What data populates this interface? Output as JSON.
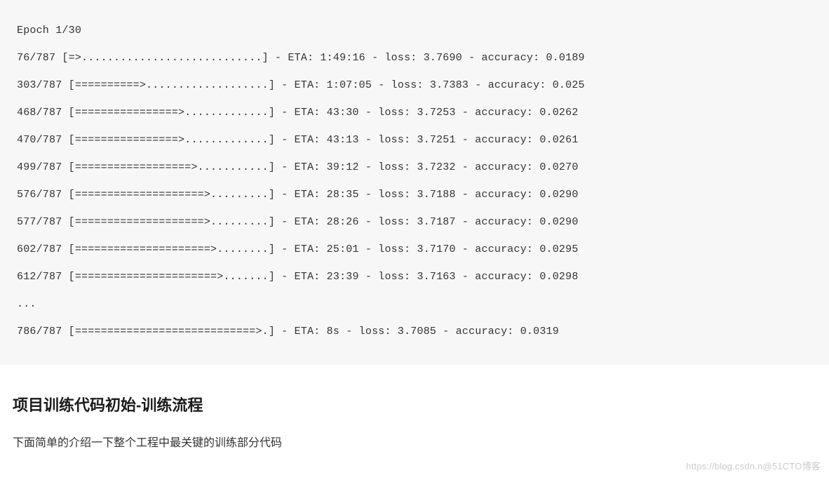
{
  "code": {
    "lines": [
      "Epoch 1/30",
      "76/787 [=>............................] - ETA: 1:49:16 - loss: 3.7690 - accuracy: 0.0189",
      "303/787 [==========>...................] - ETA: 1:07:05 - loss: 3.7383 - accuracy: 0.025",
      "468/787 [================>.............] - ETA: 43:30 - loss: 3.7253 - accuracy: 0.0262",
      "470/787 [================>.............] - ETA: 43:13 - loss: 3.7251 - accuracy: 0.0261",
      "499/787 [==================>...........] - ETA: 39:12 - loss: 3.7232 - accuracy: 0.0270",
      "576/787 [====================>.........] - ETA: 28:35 - loss: 3.7188 - accuracy: 0.0290",
      "577/787 [====================>.........] - ETA: 28:26 - loss: 3.7187 - accuracy: 0.0290",
      "602/787 [=====================>........] - ETA: 25:01 - loss: 3.7170 - accuracy: 0.0295",
      "612/787 [======================>.......] - ETA: 23:39 - loss: 3.7163 - accuracy: 0.0298",
      "...",
      "786/787 [============================>.] - ETA: 8s - loss: 3.7085 - accuracy: 0.0319"
    ]
  },
  "heading": "项目训练代码初始-训练流程",
  "paragraph": "下面简单的介绍一下整个工程中最关键的训练部分代码",
  "watermark": "https://blog.csdn.n@51CTO博客"
}
